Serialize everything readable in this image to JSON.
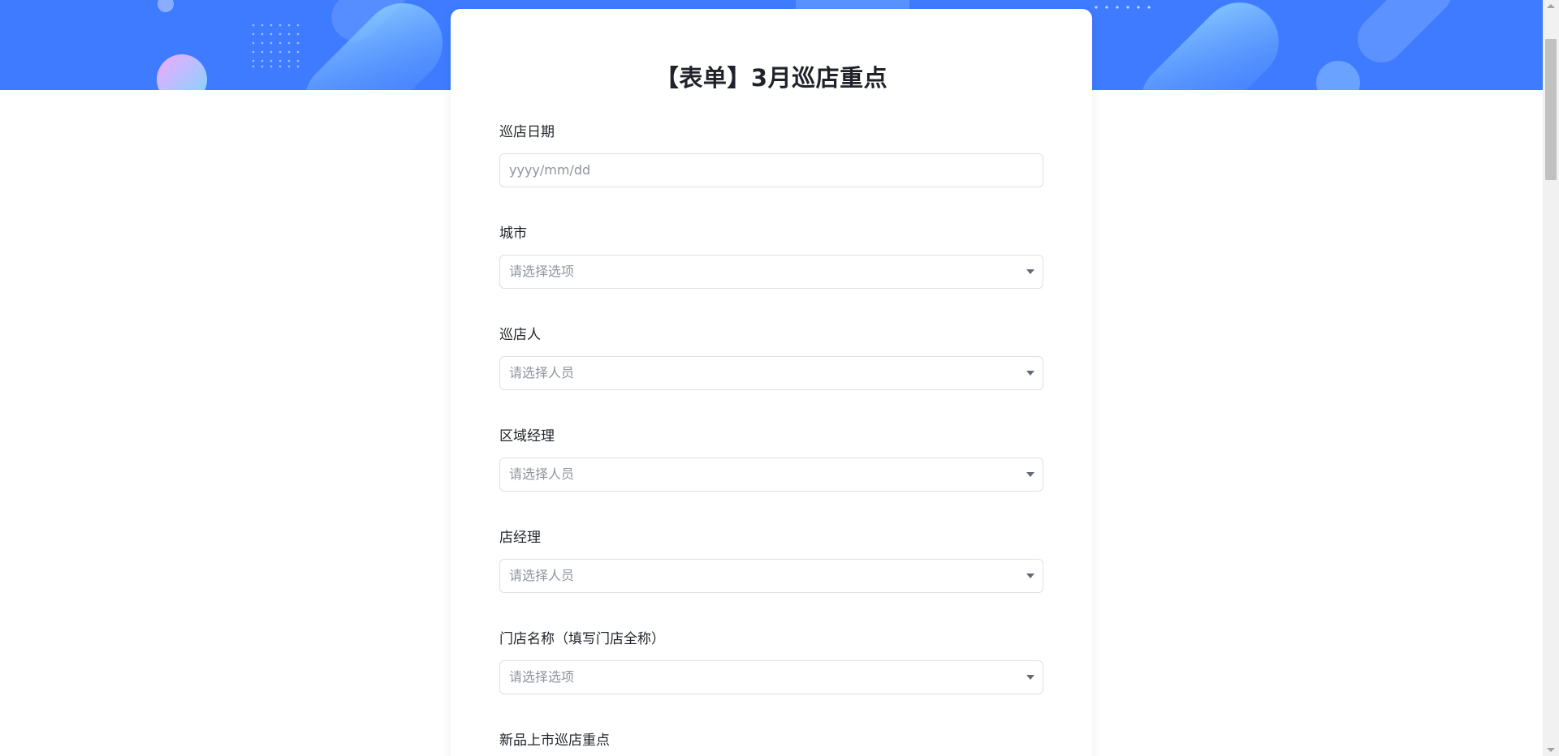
{
  "form": {
    "title": "【表单】3月巡店重点",
    "fields": [
      {
        "label": "巡店日期",
        "placeholder": "yyyy/mm/dd",
        "type": "date"
      },
      {
        "label": "城市",
        "placeholder": "请选择选项",
        "type": "select"
      },
      {
        "label": "巡店人",
        "placeholder": "请选择人员",
        "type": "person"
      },
      {
        "label": "区域经理",
        "placeholder": "请选择人员",
        "type": "person"
      },
      {
        "label": "店经理",
        "placeholder": "请选择人员",
        "type": "person"
      },
      {
        "label": "门店名称（填写门店全称）",
        "placeholder": "请选择选项",
        "type": "select"
      },
      {
        "label": "新品上市巡店重点",
        "placeholder": "",
        "type": "text"
      }
    ]
  },
  "colors": {
    "banner": "#3f7bff",
    "label_text": "#1f2329",
    "placeholder_text": "#8f959e",
    "border": "#dee0e3"
  },
  "icons": {
    "dropdown": "chevron-down-icon",
    "scroll_up": "scroll-up-arrow-icon",
    "scroll_down": "scroll-down-arrow-icon"
  }
}
